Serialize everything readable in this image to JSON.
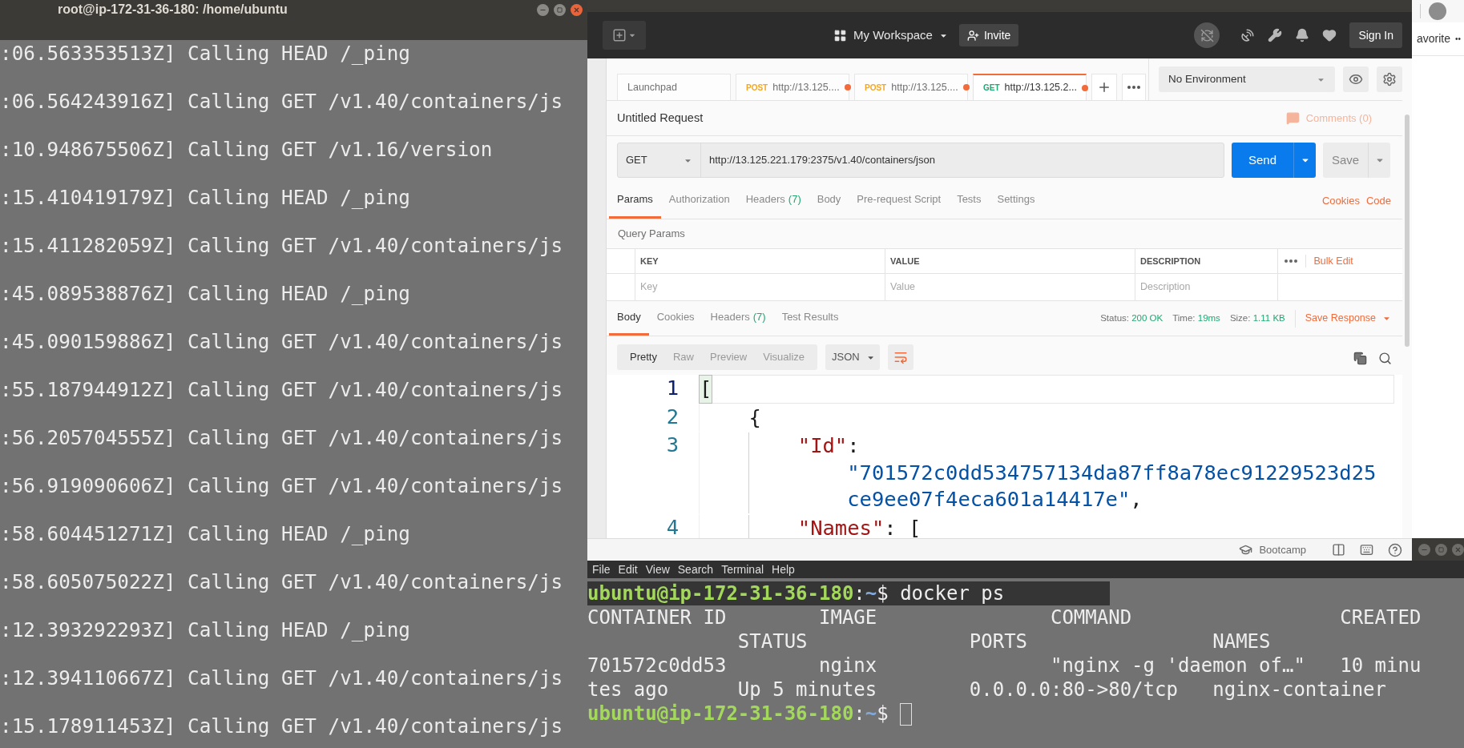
{
  "terminal_left": {
    "title": "root@ip-172-31-36-180: /home/ubuntu",
    "lines": [
      ":06.563353513Z] Calling HEAD /_ping",
      ":06.564243916Z] Calling GET /v1.40/containers/js",
      ":10.948675506Z] Calling GET /v1.16/version",
      ":15.410419179Z] Calling HEAD /_ping",
      ":15.411282059Z] Calling GET /v1.40/containers/js",
      ":45.089538876Z] Calling HEAD /_ping",
      ":45.090159886Z] Calling GET /v1.40/containers/js",
      ":55.187944912Z] Calling GET /v1.40/containers/js",
      ":56.205704555Z] Calling GET /v1.40/containers/js",
      ":56.919090606Z] Calling GET /v1.40/containers/js",
      ":58.604451271Z] Calling HEAD /_ping",
      ":58.605075022Z] Calling GET /v1.40/containers/js",
      ":12.393292293Z] Calling HEAD /_ping",
      ":12.394110667Z] Calling GET /v1.40/containers/js",
      ":15.178911453Z] Calling GET /v1.40/containers/js"
    ]
  },
  "postman": {
    "workspace": "My Workspace",
    "invite": "Invite",
    "sign_in": "Sign In",
    "tabs": [
      {
        "label": "Launchpad",
        "selected": false,
        "unsaved": false
      },
      {
        "method": "POST",
        "label": "http://13.125....",
        "selected": false,
        "unsaved": true
      },
      {
        "method": "POST",
        "label": "http://13.125....",
        "selected": false,
        "unsaved": true
      },
      {
        "method": "GET",
        "label": "http://13.125.2...",
        "selected": true,
        "unsaved": true
      }
    ],
    "environment": "No Environment",
    "request": {
      "title": "Untitled Request",
      "comments": "Comments (0)",
      "method": "GET",
      "url": "http://13.125.221.179:2375/v1.40/containers/json",
      "send": "Send",
      "save": "Save"
    },
    "request_tabs": [
      {
        "label": "Params",
        "selected": true
      },
      {
        "label": "Authorization",
        "selected": false
      },
      {
        "label": "Headers",
        "count": "(7)",
        "selected": false
      },
      {
        "label": "Body",
        "selected": false
      },
      {
        "label": "Pre-request Script",
        "selected": false
      },
      {
        "label": "Tests",
        "selected": false
      },
      {
        "label": "Settings",
        "selected": false
      }
    ],
    "request_links": [
      "Cookies",
      "Code"
    ],
    "query_params": {
      "title": "Query Params",
      "columns": [
        "KEY",
        "VALUE",
        "DESCRIPTION"
      ],
      "bulk_edit": "Bulk Edit",
      "placeholders": [
        "Key",
        "Value",
        "Description"
      ]
    },
    "response_tabs": [
      {
        "label": "Body",
        "selected": true
      },
      {
        "label": "Cookies",
        "selected": false
      },
      {
        "label": "Headers",
        "count": "(7)",
        "selected": false
      },
      {
        "label": "Test Results",
        "selected": false
      }
    ],
    "response_status": [
      {
        "label": "Status:",
        "value": "200 OK"
      },
      {
        "label": "Time:",
        "value": "19ms"
      },
      {
        "label": "Size:",
        "value": "1.11 KB"
      }
    ],
    "save_response": "Save Response",
    "view_modes": [
      {
        "label": "Pretty",
        "selected": true
      },
      {
        "label": "Raw",
        "selected": false
      },
      {
        "label": "Preview",
        "selected": false
      },
      {
        "label": "Visualize",
        "selected": false
      }
    ],
    "format": "JSON",
    "code": [
      {
        "number": "1",
        "active": true,
        "tokens": [
          {
            "kind": "punct",
            "text": "["
          }
        ],
        "children": [
          {
            "number": "2",
            "active": false,
            "tokens": [
              {
                "kind": "punct",
                "text": "{"
              }
            ],
            "children": [
              {
                "number": "3",
                "active": false,
                "tokens": [
                  {
                    "kind": "key",
                    "text": "\"Id\""
                  },
                  {
                    "kind": "punct",
                    "text": ":"
                  }
                ],
                "value": {
                  "text": "\"701572c0dd534757134da87ff8a78ec91229523d25ce9ee07f4eca601a14417e\"",
                  "suffix": ","
                }
              },
              {
                "number": "4",
                "active": false,
                "tokens": [
                  {
                    "kind": "key",
                    "text": "\"Names\""
                  },
                  {
                    "kind": "punct",
                    "text": ": ["
                  }
                ]
              }
            ]
          }
        ]
      }
    ],
    "footer": "Bootcamp"
  },
  "browser": {
    "bookmark": "avorite",
    "more": "••"
  },
  "terminal_bottom": {
    "menu": [
      "File",
      "Edit",
      "View",
      "Search",
      "Terminal",
      "Help"
    ],
    "lines": [
      {
        "kind": "prompt",
        "user_host": "ubuntu@ip-172-31-36-180",
        "separator": ":",
        "path": "~",
        "symbol": "$",
        "command": "docker ps",
        "cursor": false
      },
      {
        "kind": "output",
        "text": "CONTAINER ID        IMAGE               COMMAND                  CREATED"
      },
      {
        "kind": "output",
        "text": "             STATUS              PORTS                NAMES"
      },
      {
        "kind": "output",
        "text": "701572c0dd53        nginx               \"nginx -g 'daemon of…\"   10 minu"
      },
      {
        "kind": "output",
        "text": "tes ago      Up 5 minutes        0.0.0.0:80->80/tcp   nginx-container"
      },
      {
        "kind": "prompt",
        "user_host": "ubuntu@ip-172-31-36-180",
        "separator": ":",
        "path": "~",
        "symbol": "$",
        "cursor": true
      }
    ]
  }
}
